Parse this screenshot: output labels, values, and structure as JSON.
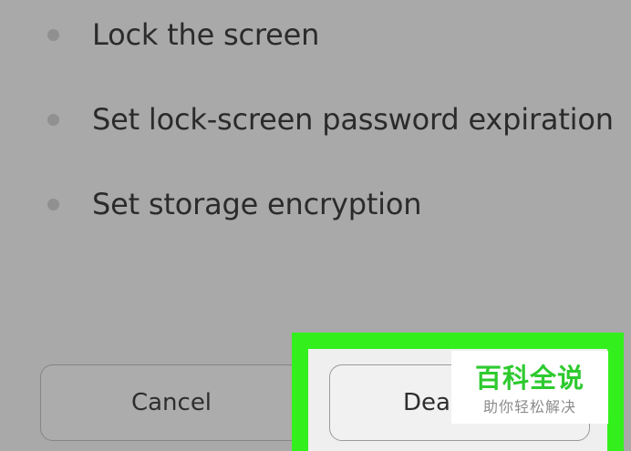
{
  "policies": [
    {
      "label": "Lock the screen"
    },
    {
      "label": "Set lock-screen password expiration"
    },
    {
      "label": "Set storage encryption"
    }
  ],
  "buttons": {
    "cancel_label": "Cancel",
    "deactivate_label": "Deac"
  },
  "watermark": {
    "title": "百科全说",
    "subtitle": "助你轻松解决"
  },
  "colors": {
    "highlight": "#33f01c",
    "watermark_title": "#2eca2f",
    "dimmed_background": "#a9a9a9"
  }
}
